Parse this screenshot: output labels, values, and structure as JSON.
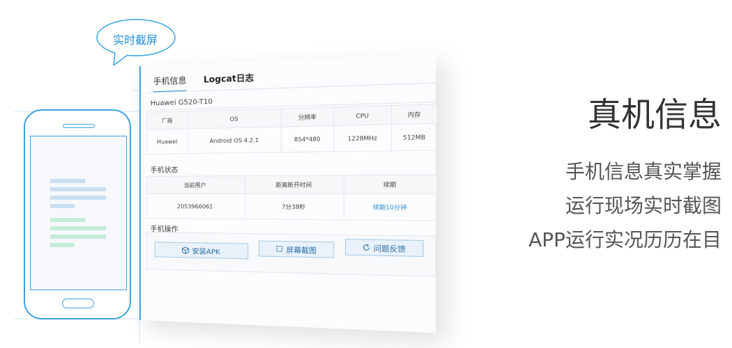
{
  "bubble": {
    "text": "实时截屏",
    "icon": "speech-bubble-icon"
  },
  "panel": {
    "tabs": [
      {
        "label": "手机信息",
        "active": true
      },
      {
        "label": "Logcat日志",
        "active": false
      }
    ],
    "device_model": "Huawei G520-T10",
    "device_table": {
      "headers": [
        "厂商",
        "OS",
        "分辨率",
        "CPU",
        "内存"
      ],
      "values": [
        "Huawei",
        "Android OS 4.2.1",
        "854*480",
        "1228MHz",
        "512MB"
      ]
    },
    "status_title": "手机状态",
    "status_table": {
      "headers": [
        "当前用户",
        "距离断开时间",
        "续期"
      ],
      "values": [
        "2053966061",
        "7分38秒",
        "续期10分钟"
      ]
    },
    "ops_title": "手机操作",
    "buttons": {
      "install": "安装APK",
      "screenshot": "屏幕截图",
      "feedback": "问题反馈"
    }
  },
  "headline": "真机信息",
  "features": [
    "手机信息真实掌握",
    "运行现场实时截图",
    "APP运行实况历历在目"
  ],
  "colors": {
    "accent": "#3aa3e0",
    "link": "#2a8ed8"
  }
}
